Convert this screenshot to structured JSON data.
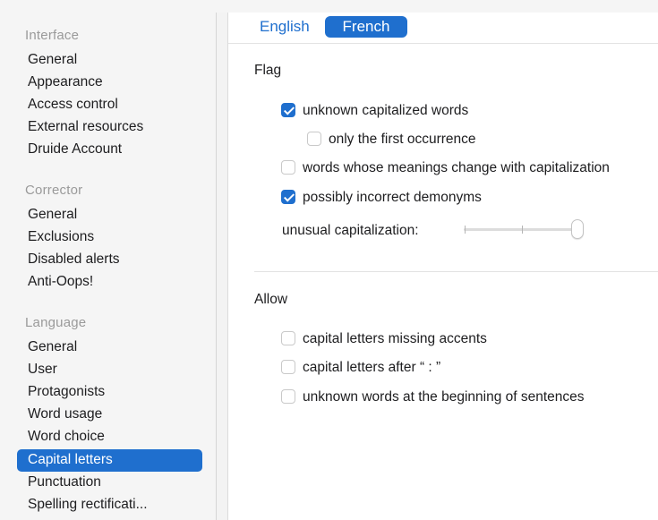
{
  "sidebar": {
    "sections": [
      {
        "title": "Interface",
        "items": [
          "General",
          "Appearance",
          "Access control",
          "External resources",
          "Druide Account"
        ]
      },
      {
        "title": "Corrector",
        "items": [
          "General",
          "Exclusions",
          "Disabled alerts",
          "Anti-Oops!"
        ]
      },
      {
        "title": "Language",
        "items": [
          "General",
          "User",
          "Protagonists",
          "Word usage",
          "Word choice",
          "Capital letters",
          "Punctuation",
          "Spelling rectificati..."
        ]
      }
    ],
    "selected": "Capital letters"
  },
  "language_tabs": {
    "english": "English",
    "french": "French",
    "selected": "French"
  },
  "flag": {
    "label": "Flag",
    "options": [
      {
        "label": "unknown capitalized words",
        "checked": true
      },
      {
        "label": "only the first occurrence",
        "checked": false
      },
      {
        "label": "words whose meanings change with capitalization",
        "checked": false
      },
      {
        "label": "possibly incorrect demonyms",
        "checked": true
      }
    ],
    "slider_label": "unusual capitalization:",
    "slider_value_fraction": 1.0
  },
  "allow": {
    "label": "Allow",
    "options": [
      {
        "label": "capital letters missing accents",
        "checked": false
      },
      {
        "label": "capital letters after “ : ”",
        "checked": false
      },
      {
        "label": "unknown words at the beginning of sentences",
        "checked": false
      }
    ]
  },
  "colors": {
    "accent": "#1f6fce",
    "sidebar_bg": "#f5f5f5"
  }
}
